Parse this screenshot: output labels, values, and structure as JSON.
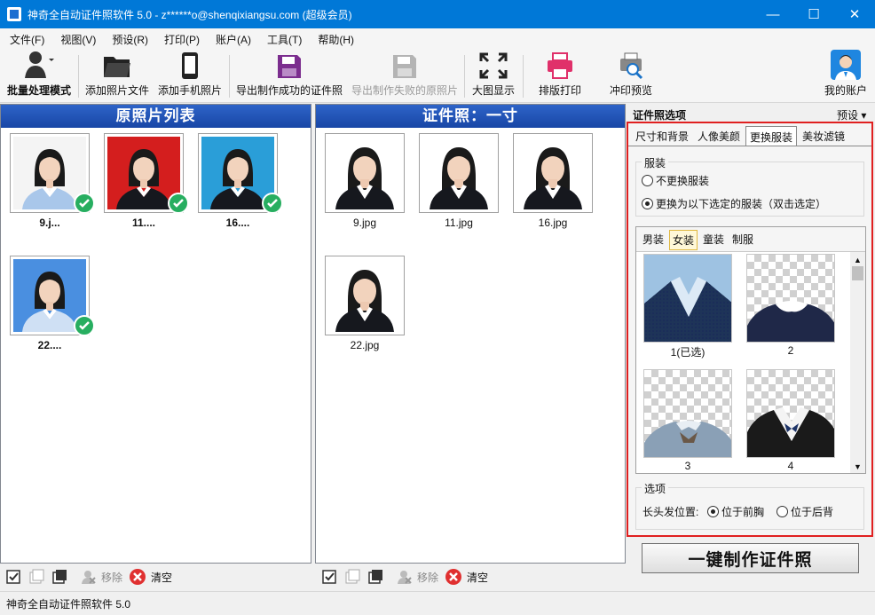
{
  "window": {
    "title": "神奇全自动证件照软件 5.0 - z******o@shenqixiangsu.com (超级会员)",
    "minimize": "—",
    "maximize": "☐",
    "close": "✕"
  },
  "menu": [
    "文件(F)",
    "视图(V)",
    "预设(R)",
    "打印(P)",
    "账户(A)",
    "工具(T)",
    "帮助(H)"
  ],
  "toolbar": {
    "batch": "批量处理模式",
    "add_photo": "添加照片文件",
    "add_phone": "添加手机照片",
    "export_success": "导出制作成功的证件照",
    "export_fail": "导出制作失败的原照片",
    "big_view": "大图显示",
    "layout_print": "排版打印",
    "print_preview": "冲印预览",
    "my_account": "我的账户"
  },
  "left_panel": {
    "title": "原照片列表",
    "items": [
      {
        "name": "9.j...",
        "bg": "#f4f4f4"
      },
      {
        "name": "11....",
        "bg": "#d41e1e"
      },
      {
        "name": "16....",
        "bg": "#2a9ed8"
      },
      {
        "name": "22....",
        "bg": "#4a8fe0"
      }
    ],
    "remove": "移除",
    "clear": "清空"
  },
  "mid_panel": {
    "title": "证件照：一寸",
    "items": [
      {
        "name": "9.jpg"
      },
      {
        "name": "11.jpg"
      },
      {
        "name": "16.jpg"
      },
      {
        "name": "22.jpg"
      }
    ],
    "remove": "移除",
    "clear": "清空"
  },
  "options": {
    "header": "证件照选项",
    "preset": "预设 ▾",
    "tabs": [
      "尺寸和背景",
      "人像美颜",
      "更换服装",
      "美妆滤镜"
    ],
    "active_tab": "更换服装",
    "clothing_group": "服装",
    "radio_keep": "不更换服装",
    "radio_change": "更换为以下选定的服装（双击选定）",
    "subtabs": [
      "男装",
      "女装",
      "童装",
      "制服"
    ],
    "active_subtab": "女装",
    "outfits": [
      {
        "label": "1(已选)"
      },
      {
        "label": "2"
      },
      {
        "label": "3"
      },
      {
        "label": "4"
      }
    ],
    "options_group": "选项",
    "hair_label": "长头发位置:",
    "hair_front": "位于前胸",
    "hair_back": "位于后背",
    "make_button": "一键制作证件照"
  },
  "status": {
    "text": "神奇全自动证件照软件 5.0"
  },
  "colors": {
    "title_bar": "#0078d7",
    "panel_header": "#1e50b4",
    "check": "#27ae60",
    "clear_icon": "#e03030",
    "selection_border": "#e02020"
  }
}
